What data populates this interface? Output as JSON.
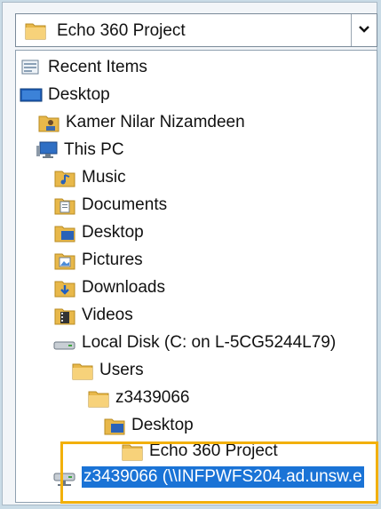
{
  "combo": {
    "value": "Echo 360 Project",
    "icon": "folder-icon"
  },
  "items": [
    {
      "label": "Recent Items",
      "icon": "recent-items-icon"
    },
    {
      "label": "Desktop",
      "icon": "desktop-icon"
    },
    {
      "label": "Kamer Nilar Nizamdeen",
      "icon": "user-folder-icon"
    },
    {
      "label": "This PC",
      "icon": "computer-icon"
    },
    {
      "label": "Music",
      "icon": "music-folder-icon"
    },
    {
      "label": "Documents",
      "icon": "documents-folder-icon"
    },
    {
      "label": "Desktop",
      "icon": "desktop-folder-icon"
    },
    {
      "label": "Pictures",
      "icon": "pictures-folder-icon"
    },
    {
      "label": "Downloads",
      "icon": "downloads-folder-icon"
    },
    {
      "label": "Videos",
      "icon": "videos-folder-icon"
    },
    {
      "label": "Local Disk (C: on L-5CG5244L79)",
      "icon": "drive-icon"
    },
    {
      "label": "Users",
      "icon": "folder-icon"
    },
    {
      "label": "z3439066",
      "icon": "folder-icon"
    },
    {
      "label": "Desktop",
      "icon": "desktop-folder-icon"
    },
    {
      "label": "Echo 360 Project",
      "icon": "folder-icon"
    },
    {
      "label": "z3439066 (\\\\INFPWFS204.ad.unsw.e",
      "icon": "network-drive-icon"
    }
  ],
  "colors": {
    "selection": "#1a73d6",
    "highlight_box": "#f2b00a"
  }
}
